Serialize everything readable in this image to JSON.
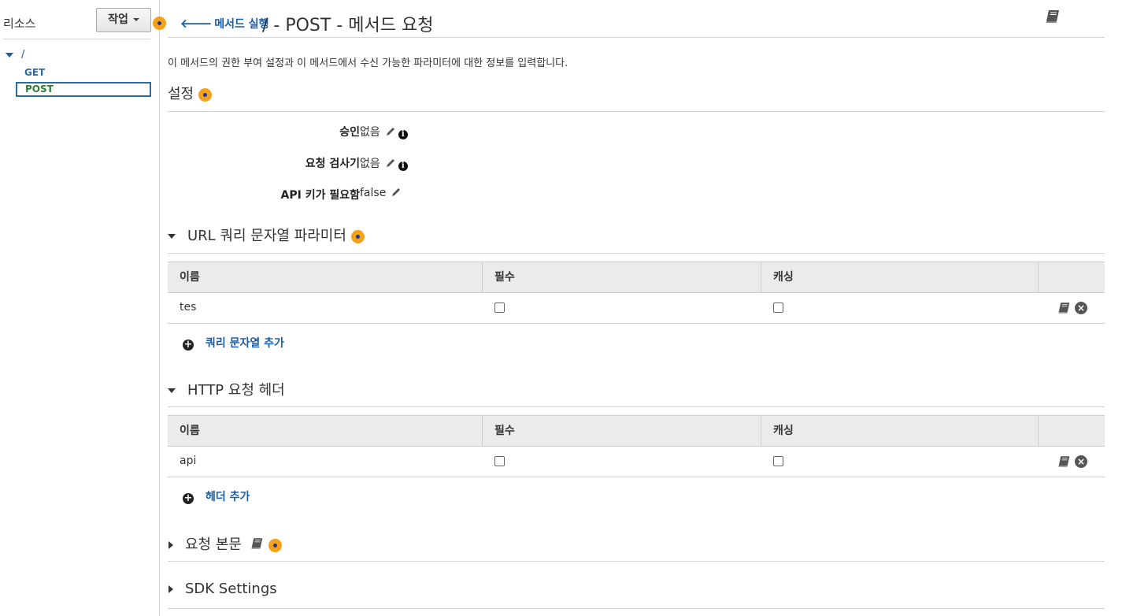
{
  "sidebar": {
    "title": "리소스",
    "action_button": "작업",
    "tree": {
      "root": "/",
      "methods": [
        "GET",
        "POST"
      ]
    }
  },
  "header": {
    "back_link": "메서드 실행",
    "title": "/ - POST - 메서드 요청"
  },
  "description": "이 메서드의 권한 부여 설정과 이 메서드에서 수신 가능한 파라미터에 대한 정보를 입력합니다.",
  "settings": {
    "heading": "설정",
    "rows": [
      {
        "label": "승인",
        "value": "없음"
      },
      {
        "label": "요청 검사기",
        "value": "없음"
      },
      {
        "label": "API 키가 필요함",
        "value": "false"
      }
    ]
  },
  "query_params": {
    "heading": "URL 쿼리 문자열 파라미터",
    "columns": [
      "이름",
      "필수",
      "캐싱"
    ],
    "rows": [
      {
        "name": "tes",
        "required": false,
        "caching": false
      }
    ],
    "add_label": "쿼리 문자열 추가"
  },
  "headers": {
    "heading": "HTTP 요청 헤더",
    "columns": [
      "이름",
      "필수",
      "캐싱"
    ],
    "rows": [
      {
        "name": "api",
        "required": false,
        "caching": false
      }
    ],
    "add_label": "헤더 추가"
  },
  "request_body": {
    "heading": "요청 본문"
  },
  "sdk_settings": {
    "heading": "SDK Settings"
  },
  "colors": {
    "link": "#1a5ea8",
    "post_method": "#2e7d32",
    "help_badge": "#f7a11a"
  },
  "icons": [
    "back-arrow-icon",
    "help-icon",
    "book-icon",
    "pencil-icon",
    "info-icon",
    "plus-circle-icon",
    "remove-circle-icon",
    "caret-down-icon",
    "caret-right-icon"
  ]
}
